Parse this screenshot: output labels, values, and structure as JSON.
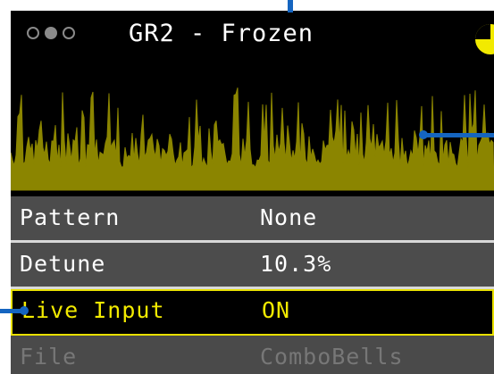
{
  "header": {
    "title": "GR2 - Frozen",
    "page_dots": [
      "inactive",
      "active",
      "inactive"
    ],
    "status_icon": "clock-pie-icon"
  },
  "waveform": {
    "color": "#8b8500"
  },
  "params": [
    {
      "label": "Pattern",
      "value": "None",
      "state": "normal"
    },
    {
      "label": "Detune",
      "value": "10.3%",
      "state": "normal"
    },
    {
      "label": "Live Input",
      "value": "ON",
      "state": "selected"
    },
    {
      "label": "File",
      "value": "ComboBells",
      "state": "disabled"
    }
  ],
  "colors": {
    "accent": "#f2ea00",
    "row_bg": "#4c4c4c",
    "callout": "#1565c0"
  }
}
